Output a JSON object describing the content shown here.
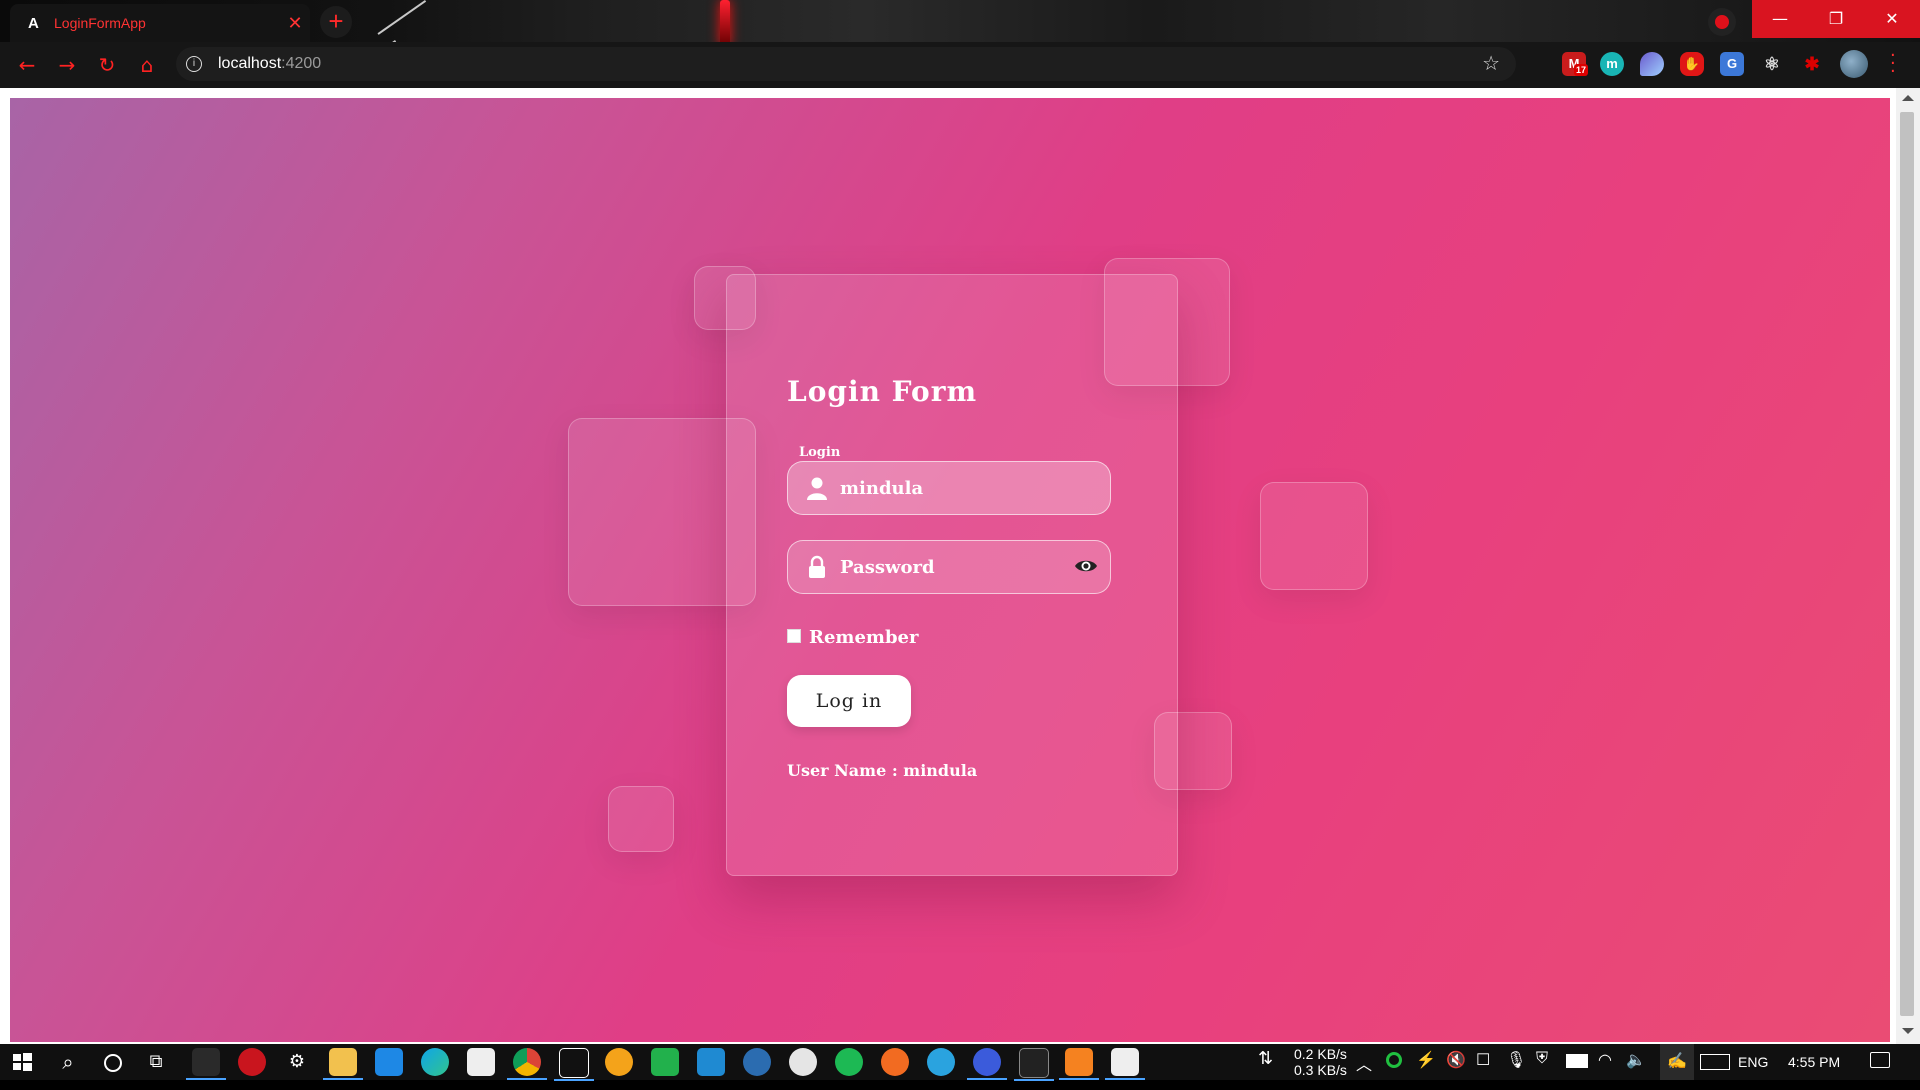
{
  "browser": {
    "tab_title": "LoginFormApp",
    "tab_favicon": "A",
    "new_tab_symbol": "+",
    "url_host": "localhost",
    "url_port": ":4200",
    "extension_badge": "17"
  },
  "login_form": {
    "title": "Login Form",
    "field_label": "Login",
    "username_value": "mindula",
    "password_placeholder": "Password",
    "remember_label": "Remember",
    "button_label": "Log in",
    "status_text": "User Name : mindula"
  },
  "taskbar": {
    "download_speed": "0.2 KB/s",
    "upload_speed": "0.3 KB/s",
    "language": "ENG",
    "time": "4:55 PM"
  },
  "colors": {
    "accent": "#ff2222",
    "gradient_start": "#a864a6",
    "gradient_mid": "#e03e86",
    "gradient_end": "#ea4c74"
  }
}
